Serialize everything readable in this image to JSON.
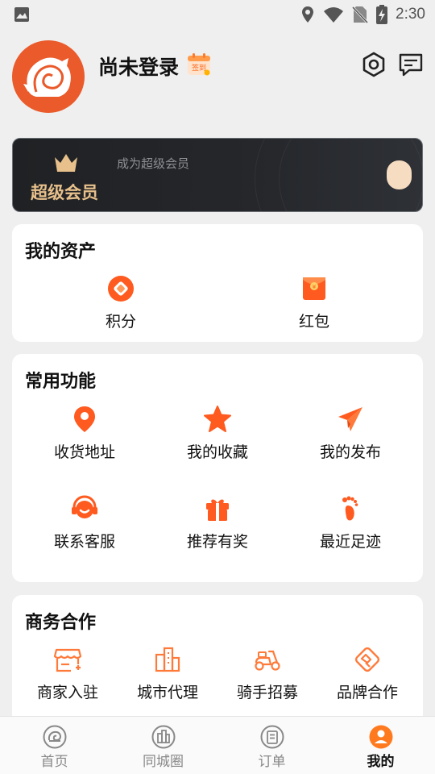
{
  "status_bar": {
    "time": "2:30"
  },
  "profile": {
    "username": "尚未登录",
    "signin_badge": "签到"
  },
  "vip": {
    "title": "超级会员",
    "subtitle": "成为超级会员"
  },
  "assets": {
    "title": "我的资产",
    "items": [
      {
        "label": "积分",
        "icon": "points-icon"
      },
      {
        "label": "红包",
        "icon": "red-packet-icon"
      }
    ]
  },
  "functions": {
    "title": "常用功能",
    "items": [
      {
        "label": "收货地址",
        "icon": "location-pin-icon"
      },
      {
        "label": "我的收藏",
        "icon": "star-icon"
      },
      {
        "label": "我的发布",
        "icon": "paper-plane-icon"
      },
      {
        "label": "联系客服",
        "icon": "headset-icon"
      },
      {
        "label": "推荐有奖",
        "icon": "gift-icon"
      },
      {
        "label": "最近足迹",
        "icon": "footprint-icon"
      }
    ]
  },
  "business": {
    "title": "商务合作",
    "items": [
      {
        "label": "商家入驻",
        "icon": "storefront-icon"
      },
      {
        "label": "城市代理",
        "icon": "city-buildings-icon"
      },
      {
        "label": "骑手招募",
        "icon": "scooter-icon"
      },
      {
        "label": "品牌合作",
        "icon": "handshake-icon"
      }
    ]
  },
  "tabbar": {
    "items": [
      {
        "label": "首页",
        "active": false
      },
      {
        "label": "同城圈",
        "active": false
      },
      {
        "label": "订单",
        "active": false
      },
      {
        "label": "我的",
        "active": true
      }
    ]
  },
  "colors": {
    "accent": "#ff5a1f",
    "vip_gold": "#e7c08b",
    "background": "#efefef"
  }
}
